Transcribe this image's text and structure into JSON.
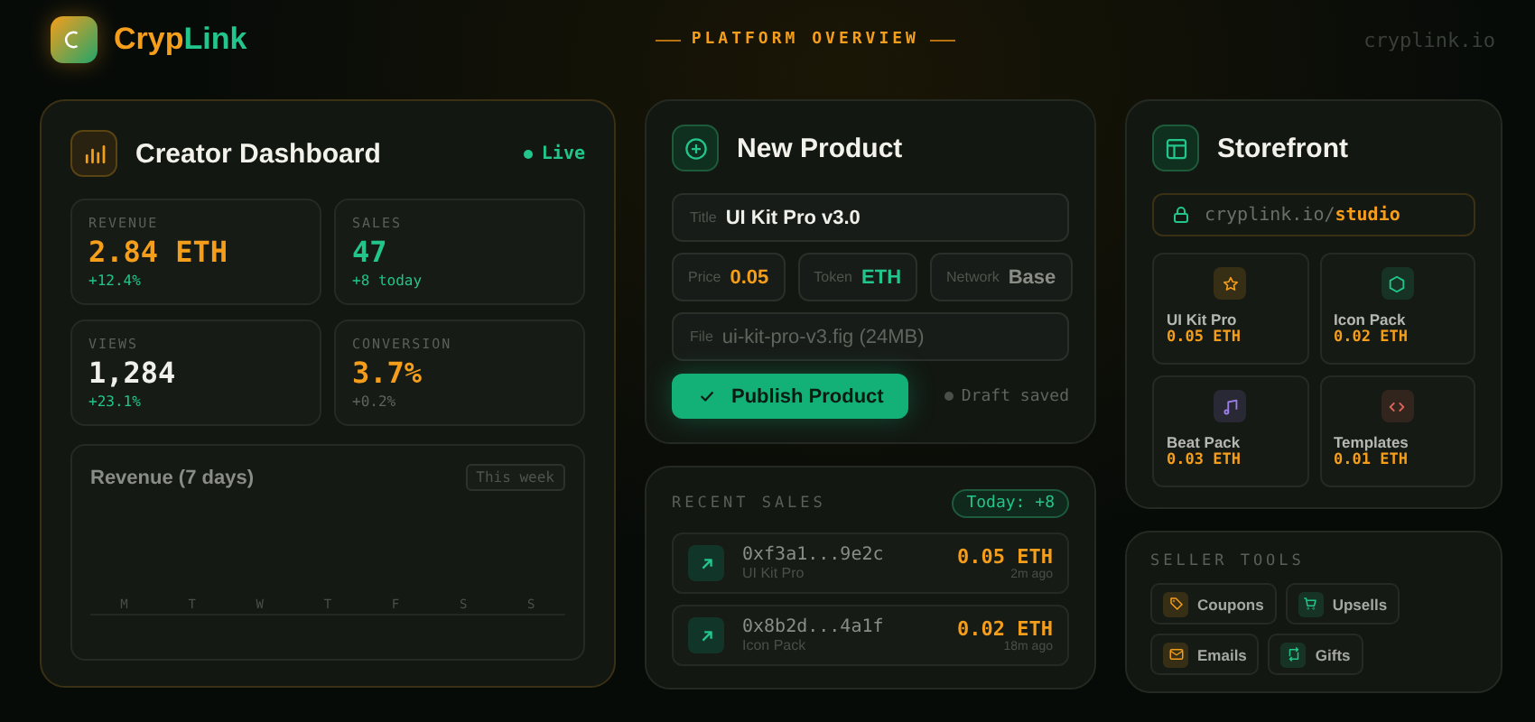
{
  "header": {
    "brand": [
      {
        "text": "Cryp",
        "color": "#f59e1b"
      },
      {
        "text": "Link",
        "color": "#22c58b"
      }
    ],
    "section_title": "PLATFORM OVERVIEW",
    "domain": "cryplink.io"
  },
  "dashboard": {
    "title": "Creator Dashboard",
    "status": "Live",
    "stats": [
      {
        "label": "REVENUE",
        "value": "2.84 ETH",
        "color": "#f59e1b",
        "change": "+12.4%",
        "kind": "up"
      },
      {
        "label": "SALES",
        "value": "47",
        "color": "#22c58b",
        "change": "+8 today",
        "kind": "up"
      },
      {
        "label": "VIEWS",
        "value": "1,284",
        "color": "#f0f0ea",
        "change": "+23.1%",
        "kind": "up"
      },
      {
        "label": "CONVERSION",
        "value": "3.7%",
        "color": "#f59e1b",
        "change": "+0.2%",
        "kind": "flat"
      }
    ],
    "chart": {
      "title": "Revenue (7 days)",
      "period": "This week",
      "days": [
        "M",
        "T",
        "W",
        "T",
        "F",
        "S",
        "S"
      ]
    }
  },
  "new_product": {
    "title": "New Product",
    "fields": [
      {
        "label": "Title",
        "value": "UI Kit Pro v3.0",
        "kind": "wide"
      },
      {
        "label": "Price",
        "value": "0.05",
        "kind": "price"
      },
      {
        "label": "Token",
        "value": "ETH",
        "kind": "token"
      },
      {
        "label": "Network",
        "value": "Base",
        "kind": "plain"
      },
      {
        "label": "File",
        "placeholder": "ui-kit-pro-v3.fig (24MB)",
        "kind": "file"
      }
    ],
    "publish_button": "Publish Product",
    "draft_status": "Draft saved"
  },
  "recent_sales": {
    "title": "RECENT SALES",
    "badge": "Today: +8",
    "rows": [
      {
        "address": "0xf3a1...9e2c",
        "product": "UI Kit Pro",
        "amount": "0.05 ETH",
        "time": "2m ago"
      },
      {
        "address": "0x8b2d...4a1f",
        "product": "Icon Pack",
        "amount": "0.02 ETH",
        "time": "18m ago"
      }
    ]
  },
  "storefront": {
    "title": "Storefront",
    "url_base": "cryplink.io/",
    "url_path": "studio",
    "products": [
      {
        "name": "UI Kit Pro",
        "price": "0.05 ETH",
        "kind": "star",
        "color": "#f59e1b"
      },
      {
        "name": "Icon Pack",
        "price": "0.02 ETH",
        "kind": "hexagon",
        "color": "#22c58b"
      },
      {
        "name": "Beat Pack",
        "price": "0.03 ETH",
        "kind": "note",
        "color": "#9b7ee8"
      },
      {
        "name": "Templates",
        "price": "0.01 ETH",
        "kind": "code",
        "color": "#e0655a"
      }
    ]
  },
  "seller_tools": {
    "title": "SELLER TOOLS",
    "tools": [
      {
        "label": "Coupons",
        "kind": "tag",
        "color": "#f59e1b"
      },
      {
        "label": "Upsells",
        "kind": "cart",
        "color": "#22c58b"
      },
      {
        "label": "Emails",
        "kind": "mail",
        "color": "#f59e1b"
      },
      {
        "label": "Gifts",
        "kind": "repeat",
        "color": "#22c58b"
      }
    ]
  }
}
